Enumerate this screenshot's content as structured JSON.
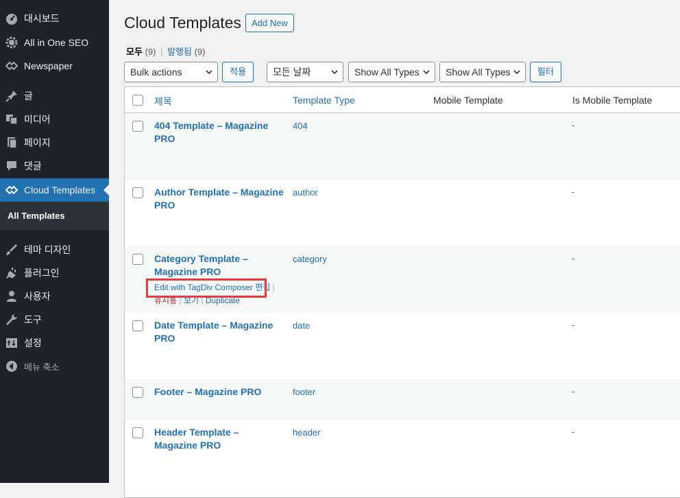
{
  "sidebar": {
    "items": [
      {
        "label": "대시보드",
        "icon": "dashboard-icon"
      },
      {
        "label": "All in One SEO",
        "icon": "gear-icon"
      },
      {
        "label": "Newspaper",
        "icon": "newspaper-icon"
      },
      {
        "label": "글",
        "icon": "pin-icon"
      },
      {
        "label": "미디어",
        "icon": "media-icon"
      },
      {
        "label": "페이지",
        "icon": "page-icon"
      },
      {
        "label": "댓글",
        "icon": "comment-icon"
      },
      {
        "label": "Cloud Templates",
        "icon": "cloud-templates-icon"
      },
      {
        "label": "테마 디자인",
        "icon": "brush-icon"
      },
      {
        "label": "플러그인",
        "icon": "plugin-icon"
      },
      {
        "label": "사용자",
        "icon": "user-icon"
      },
      {
        "label": "도구",
        "icon": "wrench-icon"
      },
      {
        "label": "설정",
        "icon": "settings-icon"
      },
      {
        "label": "메뉴 축소",
        "icon": "collapse-icon"
      }
    ],
    "submenu": {
      "label": "All Templates"
    },
    "active_color": "#2271b1"
  },
  "header": {
    "title": "Cloud Templates",
    "add_new": "Add New"
  },
  "views": {
    "all_label": "모두",
    "all_count": "(9)",
    "separator": "|",
    "published_label": "발행됨",
    "published_count": "(9)"
  },
  "filters": {
    "bulk_actions": "Bulk actions",
    "apply": "적용",
    "all_dates": "모든 날짜",
    "types_1": "Show All Types",
    "types_2": "Show All Types",
    "filter": "필터"
  },
  "table": {
    "columns": {
      "title": "제목",
      "template_type": "Template Type",
      "mobile_template": "Mobile Template",
      "is_mobile_template": "Is Mobile Template"
    },
    "rows": [
      {
        "title": "404 Template – Magazine PRO",
        "type": "404",
        "is_mobile": "-"
      },
      {
        "title": "Author Template – Magazine PRO",
        "type": "author",
        "is_mobile": "-"
      },
      {
        "title": "Category Template – Magazine PRO",
        "type": "category",
        "is_mobile": "-"
      },
      {
        "title": "Date Template – Magazine PRO",
        "type": "date",
        "is_mobile": "-"
      },
      {
        "title": "Footer – Magazine PRO",
        "type": "footer",
        "is_mobile": "-"
      },
      {
        "title": "Header Template – Magazine PRO",
        "type": "header",
        "is_mobile": "-"
      }
    ],
    "row_actions": {
      "edit_composer": "Edit with TagDiv Composer",
      "edit": "편집",
      "trash": "휴지통",
      "view": "보기",
      "duplicate": "Duplicate",
      "sep": "|"
    }
  },
  "highlight_color": "#e83a3a"
}
